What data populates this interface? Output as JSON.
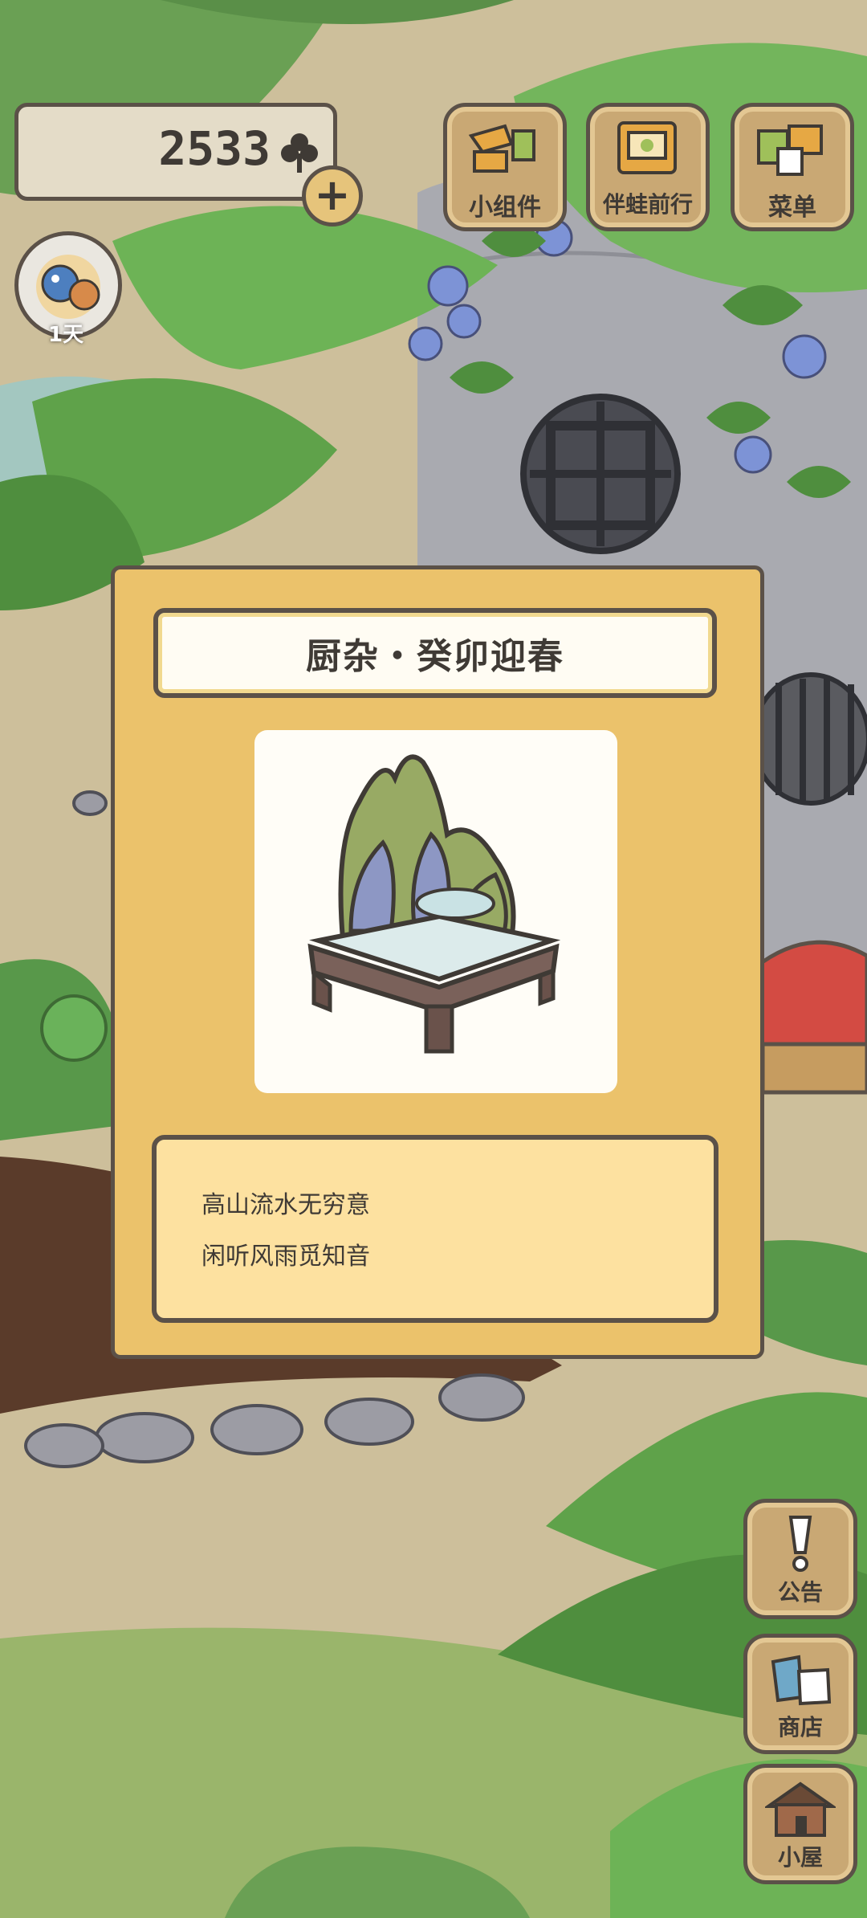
{
  "hud": {
    "clover_count": "2533",
    "plus_label": "+",
    "day_label": "1天"
  },
  "top_buttons": {
    "widgets": "小组件",
    "travel_with_frog": "伴蛙前行",
    "menu": "菜单"
  },
  "right_buttons": {
    "notice": "公告",
    "shop": "商店",
    "cabin": "小屋"
  },
  "item_panel": {
    "title": "厨杂・癸卯迎春",
    "description_line1": "高山流水无穷意",
    "description_line2": "闲听风雨觅知音"
  },
  "colors": {
    "panel_bg": "#ebc26b",
    "outline": "#5b5148",
    "desc_bg": "#fde1a0"
  }
}
